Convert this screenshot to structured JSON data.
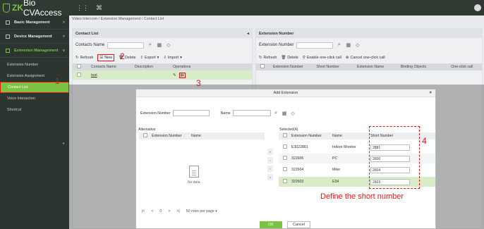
{
  "app": {
    "logo_zk": "ZK",
    "logo_rest": "Bio CVAccess"
  },
  "sidebar": {
    "groups": [
      {
        "label": "Basic Management",
        "chevron": ">"
      },
      {
        "label": "Device Management",
        "chevron": ">"
      },
      {
        "label": "Extension Management",
        "chevron": "v"
      }
    ],
    "items": [
      {
        "label": "Extension Number"
      },
      {
        "label": "Extension Assignment"
      },
      {
        "label": "Contact List"
      },
      {
        "label": "Voice Interaction"
      },
      {
        "label": "Shortcut"
      }
    ]
  },
  "breadcrumb": "Video Intercom / Extension Management / Contact List",
  "contact_panel": {
    "title": "Contact List",
    "collapse_arrow": "◂",
    "search_label": "Contacts Name",
    "toolbar": {
      "refresh": "Refresh",
      "new": "New",
      "delete": "Delete",
      "export": "Export",
      "import": "Import"
    },
    "columns": [
      "Contacts Name",
      "Description",
      "Operations"
    ],
    "rows": [
      {
        "name": "test"
      }
    ]
  },
  "extension_panel": {
    "title": "Extension Number",
    "search_label": "Extension Number",
    "toolbar": {
      "refresh": "Refresh",
      "delete": "Delete",
      "enable": "Enable one-click call",
      "cancel": "Cancel one-click call"
    },
    "columns": [
      "Extension Number",
      "Short Number",
      "Extension Name",
      "Binding Objects",
      "One-click call"
    ]
  },
  "annotations": {
    "n1": "1",
    "n2": "2",
    "n3": "3",
    "n4": "4",
    "define": "Define the short number"
  },
  "modal": {
    "title": "Add Extension",
    "close": "×",
    "search": {
      "ext_label": "Extension Number",
      "name_label": "Name"
    },
    "alternative": {
      "label": "Alternative",
      "columns": [
        "Extension Number",
        "Name"
      ],
      "no_data": "No data",
      "pager": {
        "first": "|<",
        "prev": "<",
        "page": "0",
        "next": ">",
        "last": ">|",
        "rows_per_page": "50 rows per page"
      }
    },
    "selected": {
      "label": "Selected(4)",
      "columns": [
        "Extension Number",
        "Name",
        "Short Number"
      ],
      "rows": [
        {
          "ext": "E3022881",
          "name": "Indoor Monitor",
          "short": "2881"
        },
        {
          "ext": "322606",
          "name": "PC",
          "short": "2606"
        },
        {
          "ext": "322604",
          "name": "Mike",
          "short": "2604"
        },
        {
          "ext": "322603",
          "name": "E34",
          "short": "2603"
        }
      ]
    },
    "ok": "OK",
    "cancel": "Cancel"
  }
}
